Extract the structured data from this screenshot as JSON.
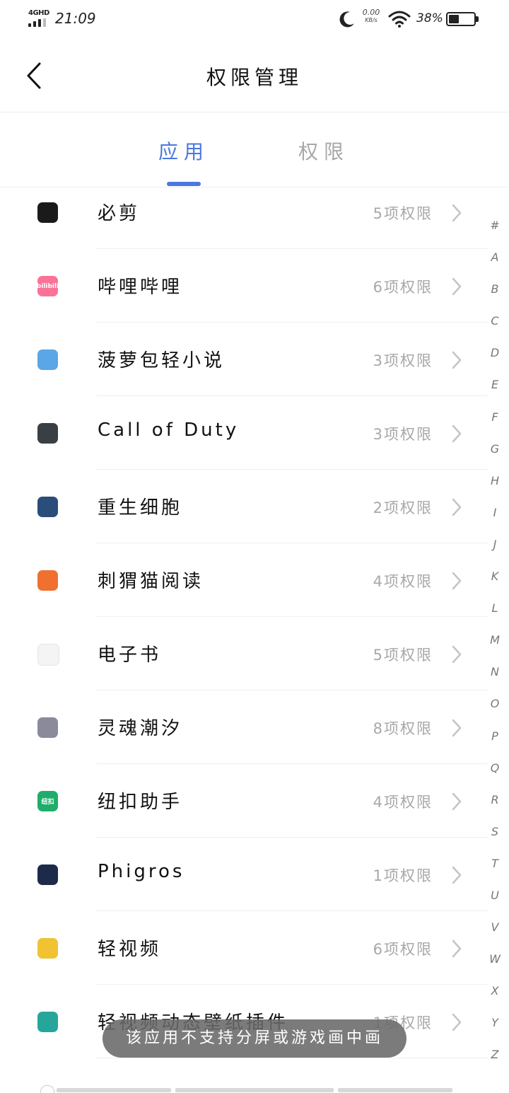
{
  "status_bar": {
    "network": "4GHD",
    "time": "21:09",
    "speed_value": "0.00",
    "speed_unit": "KB/s",
    "battery_text": "38%",
    "battery_level": 0.38,
    "icons": [
      "signal-icon",
      "moon-icon",
      "wifi-icon",
      "battery-icon"
    ]
  },
  "header": {
    "title": "权限管理",
    "back_icon": "chevron-left-icon"
  },
  "tabs": [
    {
      "label": "应用",
      "active": true
    },
    {
      "label": "权限",
      "active": false
    }
  ],
  "colors": {
    "accent": "#4a78e0",
    "secondary_text": "#a8a8a8"
  },
  "apps": [
    {
      "name": "必剪",
      "permissions": "5项权限",
      "icon": "bijian-app-icon",
      "icon_bg": "#1a1a1a",
      "icon_text": ""
    },
    {
      "name": "哔哩哔哩",
      "permissions": "6项权限",
      "icon": "bilibili-app-icon",
      "icon_bg": "#fb7299",
      "icon_text": "bilibili"
    },
    {
      "name": "菠萝包轻小说",
      "permissions": "3项权限",
      "icon": "sfacg-app-icon",
      "icon_bg": "#5aa6e6",
      "icon_text": ""
    },
    {
      "name": "Call of Duty",
      "permissions": "3项权限",
      "icon": "call-of-duty-app-icon",
      "icon_bg": "#3a3f45",
      "icon_text": ""
    },
    {
      "name": "重生细胞",
      "permissions": "2项权限",
      "icon": "dead-cells-app-icon",
      "icon_bg": "#2a4d7a",
      "icon_text": ""
    },
    {
      "name": "刺猬猫阅读",
      "permissions": "4项权限",
      "icon": "ciweimao-app-icon",
      "icon_bg": "#f07030",
      "icon_text": ""
    },
    {
      "name": "电子书",
      "permissions": "5项权限",
      "icon": "ebook-app-icon",
      "icon_bg": "#f4f4f4",
      "icon_text": ""
    },
    {
      "name": "灵魂潮汐",
      "permissions": "8项权限",
      "icon": "soul-tide-app-icon",
      "icon_bg": "#8a8a9a",
      "icon_text": ""
    },
    {
      "name": "纽扣助手",
      "permissions": "4项权限",
      "icon": "niukou-app-icon",
      "icon_bg": "#1fae6a",
      "icon_text": "纽扣"
    },
    {
      "name": "Phigros",
      "permissions": "1项权限",
      "icon": "phigros-app-icon",
      "icon_bg": "#1e2a4a",
      "icon_text": ""
    },
    {
      "name": "轻视频",
      "permissions": "6项权限",
      "icon": "light-video-app-icon",
      "icon_bg": "#f1c232",
      "icon_text": ""
    },
    {
      "name": "轻视频动态壁纸插件",
      "permissions": "1项权限",
      "icon": "android-app-icon",
      "icon_bg": "#26a69a",
      "icon_text": ""
    }
  ],
  "alphabet_index": [
    "#",
    "A",
    "B",
    "C",
    "D",
    "E",
    "F",
    "G",
    "H",
    "I",
    "J",
    "K",
    "L",
    "M",
    "N",
    "O",
    "P",
    "Q",
    "R",
    "S",
    "T",
    "U",
    "V",
    "W",
    "X",
    "Y",
    "Z"
  ],
  "toast": "该应用不支持分屏或游戏画中画"
}
